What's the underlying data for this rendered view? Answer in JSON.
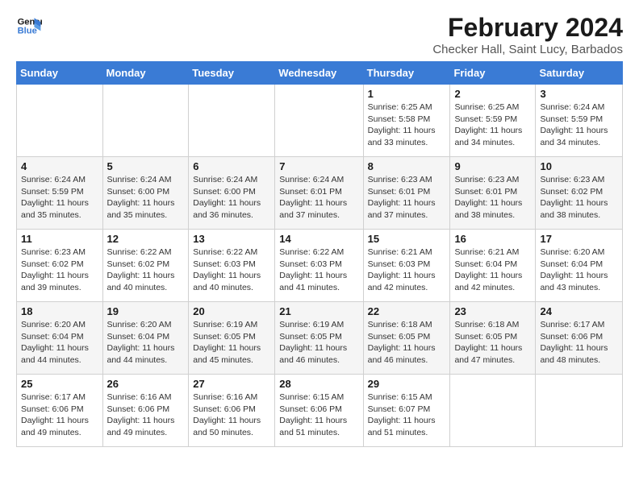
{
  "logo": {
    "line1": "General",
    "line2": "Blue"
  },
  "title": "February 2024",
  "subtitle": "Checker Hall, Saint Lucy, Barbados",
  "days_of_week": [
    "Sunday",
    "Monday",
    "Tuesday",
    "Wednesday",
    "Thursday",
    "Friday",
    "Saturday"
  ],
  "weeks": [
    [
      {
        "day": "",
        "info": ""
      },
      {
        "day": "",
        "info": ""
      },
      {
        "day": "",
        "info": ""
      },
      {
        "day": "",
        "info": ""
      },
      {
        "day": "1",
        "info": "Sunrise: 6:25 AM\nSunset: 5:58 PM\nDaylight: 11 hours and 33 minutes."
      },
      {
        "day": "2",
        "info": "Sunrise: 6:25 AM\nSunset: 5:59 PM\nDaylight: 11 hours and 34 minutes."
      },
      {
        "day": "3",
        "info": "Sunrise: 6:24 AM\nSunset: 5:59 PM\nDaylight: 11 hours and 34 minutes."
      }
    ],
    [
      {
        "day": "4",
        "info": "Sunrise: 6:24 AM\nSunset: 5:59 PM\nDaylight: 11 hours and 35 minutes."
      },
      {
        "day": "5",
        "info": "Sunrise: 6:24 AM\nSunset: 6:00 PM\nDaylight: 11 hours and 35 minutes."
      },
      {
        "day": "6",
        "info": "Sunrise: 6:24 AM\nSunset: 6:00 PM\nDaylight: 11 hours and 36 minutes."
      },
      {
        "day": "7",
        "info": "Sunrise: 6:24 AM\nSunset: 6:01 PM\nDaylight: 11 hours and 37 minutes."
      },
      {
        "day": "8",
        "info": "Sunrise: 6:23 AM\nSunset: 6:01 PM\nDaylight: 11 hours and 37 minutes."
      },
      {
        "day": "9",
        "info": "Sunrise: 6:23 AM\nSunset: 6:01 PM\nDaylight: 11 hours and 38 minutes."
      },
      {
        "day": "10",
        "info": "Sunrise: 6:23 AM\nSunset: 6:02 PM\nDaylight: 11 hours and 38 minutes."
      }
    ],
    [
      {
        "day": "11",
        "info": "Sunrise: 6:23 AM\nSunset: 6:02 PM\nDaylight: 11 hours and 39 minutes."
      },
      {
        "day": "12",
        "info": "Sunrise: 6:22 AM\nSunset: 6:02 PM\nDaylight: 11 hours and 40 minutes."
      },
      {
        "day": "13",
        "info": "Sunrise: 6:22 AM\nSunset: 6:03 PM\nDaylight: 11 hours and 40 minutes."
      },
      {
        "day": "14",
        "info": "Sunrise: 6:22 AM\nSunset: 6:03 PM\nDaylight: 11 hours and 41 minutes."
      },
      {
        "day": "15",
        "info": "Sunrise: 6:21 AM\nSunset: 6:03 PM\nDaylight: 11 hours and 42 minutes."
      },
      {
        "day": "16",
        "info": "Sunrise: 6:21 AM\nSunset: 6:04 PM\nDaylight: 11 hours and 42 minutes."
      },
      {
        "day": "17",
        "info": "Sunrise: 6:20 AM\nSunset: 6:04 PM\nDaylight: 11 hours and 43 minutes."
      }
    ],
    [
      {
        "day": "18",
        "info": "Sunrise: 6:20 AM\nSunset: 6:04 PM\nDaylight: 11 hours and 44 minutes."
      },
      {
        "day": "19",
        "info": "Sunrise: 6:20 AM\nSunset: 6:04 PM\nDaylight: 11 hours and 44 minutes."
      },
      {
        "day": "20",
        "info": "Sunrise: 6:19 AM\nSunset: 6:05 PM\nDaylight: 11 hours and 45 minutes."
      },
      {
        "day": "21",
        "info": "Sunrise: 6:19 AM\nSunset: 6:05 PM\nDaylight: 11 hours and 46 minutes."
      },
      {
        "day": "22",
        "info": "Sunrise: 6:18 AM\nSunset: 6:05 PM\nDaylight: 11 hours and 46 minutes."
      },
      {
        "day": "23",
        "info": "Sunrise: 6:18 AM\nSunset: 6:05 PM\nDaylight: 11 hours and 47 minutes."
      },
      {
        "day": "24",
        "info": "Sunrise: 6:17 AM\nSunset: 6:06 PM\nDaylight: 11 hours and 48 minutes."
      }
    ],
    [
      {
        "day": "25",
        "info": "Sunrise: 6:17 AM\nSunset: 6:06 PM\nDaylight: 11 hours and 49 minutes."
      },
      {
        "day": "26",
        "info": "Sunrise: 6:16 AM\nSunset: 6:06 PM\nDaylight: 11 hours and 49 minutes."
      },
      {
        "day": "27",
        "info": "Sunrise: 6:16 AM\nSunset: 6:06 PM\nDaylight: 11 hours and 50 minutes."
      },
      {
        "day": "28",
        "info": "Sunrise: 6:15 AM\nSunset: 6:06 PM\nDaylight: 11 hours and 51 minutes."
      },
      {
        "day": "29",
        "info": "Sunrise: 6:15 AM\nSunset: 6:07 PM\nDaylight: 11 hours and 51 minutes."
      },
      {
        "day": "",
        "info": ""
      },
      {
        "day": "",
        "info": ""
      }
    ]
  ]
}
